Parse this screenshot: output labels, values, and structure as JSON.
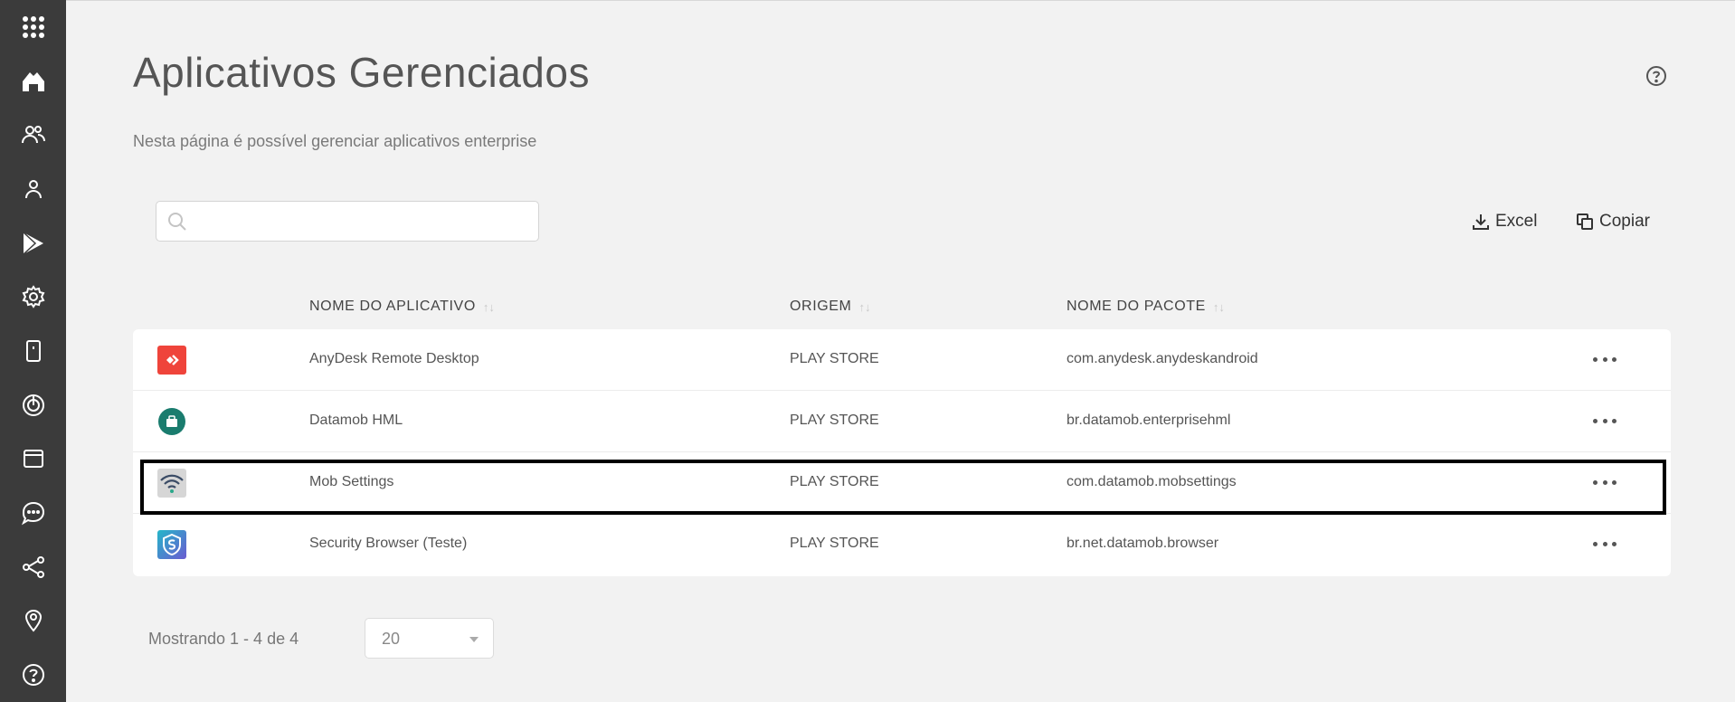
{
  "sidebar": {
    "items": [
      {
        "icon": "apps-grid-icon",
        "name": "sidebar-item-apps"
      },
      {
        "icon": "home-icon",
        "name": "sidebar-item-home"
      },
      {
        "icon": "users-icon",
        "name": "sidebar-item-users"
      },
      {
        "icon": "user-icon",
        "name": "sidebar-item-user"
      },
      {
        "icon": "play-store-icon",
        "name": "sidebar-item-play-store"
      },
      {
        "icon": "gear-icon",
        "name": "sidebar-item-settings"
      },
      {
        "icon": "device-icon",
        "name": "sidebar-item-devices"
      },
      {
        "icon": "target-icon",
        "name": "sidebar-item-target"
      },
      {
        "icon": "browser-window-icon",
        "name": "sidebar-item-browser"
      },
      {
        "icon": "chat-icon",
        "name": "sidebar-item-chat"
      },
      {
        "icon": "share-icon",
        "name": "sidebar-item-share"
      },
      {
        "icon": "location-pin-icon",
        "name": "sidebar-item-location"
      },
      {
        "icon": "help-icon",
        "name": "sidebar-item-help"
      }
    ]
  },
  "header": {
    "title": "Aplicativos Gerenciados",
    "subtitle": "Nesta página é possível gerenciar aplicativos enterprise",
    "help_icon": "help-circle-icon"
  },
  "search": {
    "value": "",
    "placeholder": ""
  },
  "toolbar": {
    "excel_label": "Excel",
    "copy_label": "Copiar"
  },
  "table": {
    "columns": {
      "name": "NOME DO APLICATIVO",
      "origin": "ORIGEM",
      "package": "NOME DO PACOTE"
    },
    "sort_glyph": "↑↓",
    "rows": [
      {
        "name": "AnyDesk Remote Desktop",
        "origin": "PLAY STORE",
        "package": "com.anydesk.anydeskandroid",
        "icon": "anydesk-app-icon"
      },
      {
        "name": "Datamob HML",
        "origin": "PLAY STORE",
        "package": "br.datamob.enterprisehml",
        "icon": "datamob-app-icon"
      },
      {
        "name": "Mob Settings",
        "origin": "PLAY STORE",
        "package": "com.datamob.mobsettings",
        "icon": "wifi-app-icon"
      },
      {
        "name": "Security Browser (Teste)",
        "origin": "PLAY STORE",
        "package": "br.net.datamob.browser",
        "icon": "security-browser-app-icon"
      }
    ]
  },
  "pagination": {
    "showing": "Mostrando 1 - 4 de 4",
    "page_size": "20"
  },
  "colors": {
    "sidebar_bg": "#3b3b3b",
    "page_bg": "#f2f2f2",
    "anydesk": "#ef443b",
    "datamob": "#1a7c6e"
  }
}
